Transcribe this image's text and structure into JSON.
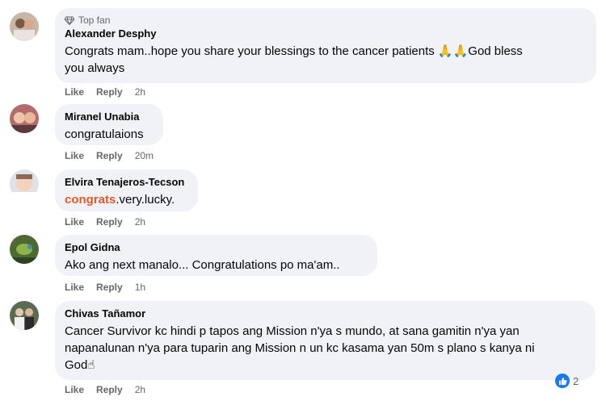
{
  "comments": [
    {
      "badge": "Top fan",
      "name": "Alexander Desphy",
      "line1": "Congrats mam..hope you share your blessings to the cancer patients 🙏🙏God bless",
      "line2": "you always",
      "like": "Like",
      "reply": "Reply",
      "time": "2h"
    },
    {
      "name": "Miranel Unabia",
      "text": "congratulaions",
      "like": "Like",
      "reply": "Reply",
      "time": "20m"
    },
    {
      "name": "Elvira Tenajeros-Tecson",
      "highlight": "congrats",
      "text_rest": ".very.lucky.",
      "like": "Like",
      "reply": "Reply",
      "time": "2h"
    },
    {
      "name": "Epol Gidna",
      "text": "Ako ang next manalo... Congratulations po ma'am..",
      "like": "Like",
      "reply": "Reply",
      "time": "1h"
    },
    {
      "name": "Chivas Tañamor",
      "line1": "Cancer Survivor kc hindi p tapos ang Mission n'ya s mundo, at sana gamitin n'ya yan",
      "line2": "napanalunan n'ya para tuparin ang Mission n un kc kasama yan 50m s plano s kanya ni",
      "line3": "God☝",
      "like": "Like",
      "reply": "Reply",
      "time": "2h",
      "reaction_count": "2"
    }
  ],
  "icons": {
    "topfan": "diamond-icon",
    "reaction": "like-reaction-icon"
  },
  "colors": {
    "bubble": "#f0f2f5",
    "highlight": "#e25a2c",
    "meta": "#65676b",
    "like_blue": "#1877f2"
  }
}
